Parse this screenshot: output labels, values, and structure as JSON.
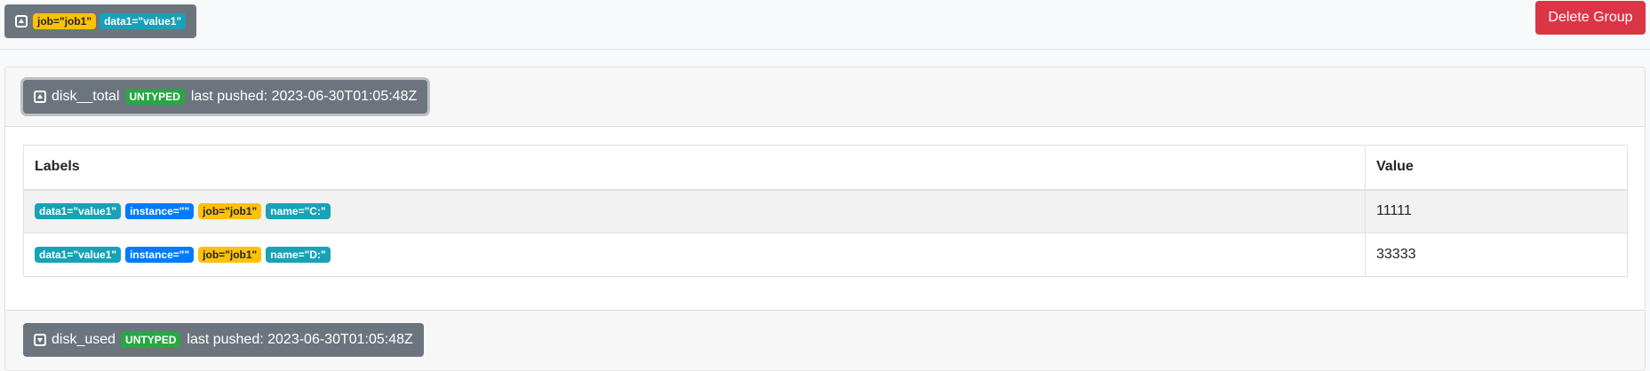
{
  "group": {
    "labels": [
      {
        "text": "job=\"job1\"",
        "style": "warning"
      },
      {
        "text": "data1=\"value1\"",
        "style": "info"
      }
    ],
    "toggle_icon": "collapse-square-icon",
    "delete_label": "Delete Group"
  },
  "metrics": [
    {
      "name": "disk__total",
      "type_badge": "UNTYPED",
      "last_pushed": "last pushed: 2023-06-30T01:05:48Z",
      "expanded": true,
      "table": {
        "headers": [
          "Labels",
          "Value"
        ],
        "rows": [
          {
            "labels": [
              {
                "text": "data1=\"value1\"",
                "style": "info"
              },
              {
                "text": "instance=\"\"",
                "style": "primary"
              },
              {
                "text": "job=\"job1\"",
                "style": "warning"
              },
              {
                "text": "name=\"C:\"",
                "style": "info"
              }
            ],
            "value": "11111"
          },
          {
            "labels": [
              {
                "text": "data1=\"value1\"",
                "style": "info"
              },
              {
                "text": "instance=\"\"",
                "style": "primary"
              },
              {
                "text": "job=\"job1\"",
                "style": "warning"
              },
              {
                "text": "name=\"D:\"",
                "style": "info"
              }
            ],
            "value": "33333"
          }
        ]
      }
    },
    {
      "name": "disk_used",
      "type_badge": "UNTYPED",
      "last_pushed": "last pushed: 2023-06-30T01:05:48Z",
      "expanded": false
    }
  ],
  "colors": {
    "secondary": "#6c757d",
    "danger": "#dc3545",
    "warning": "#ffc107",
    "info": "#17a2b8",
    "primary": "#007bff",
    "success": "#28a745"
  }
}
